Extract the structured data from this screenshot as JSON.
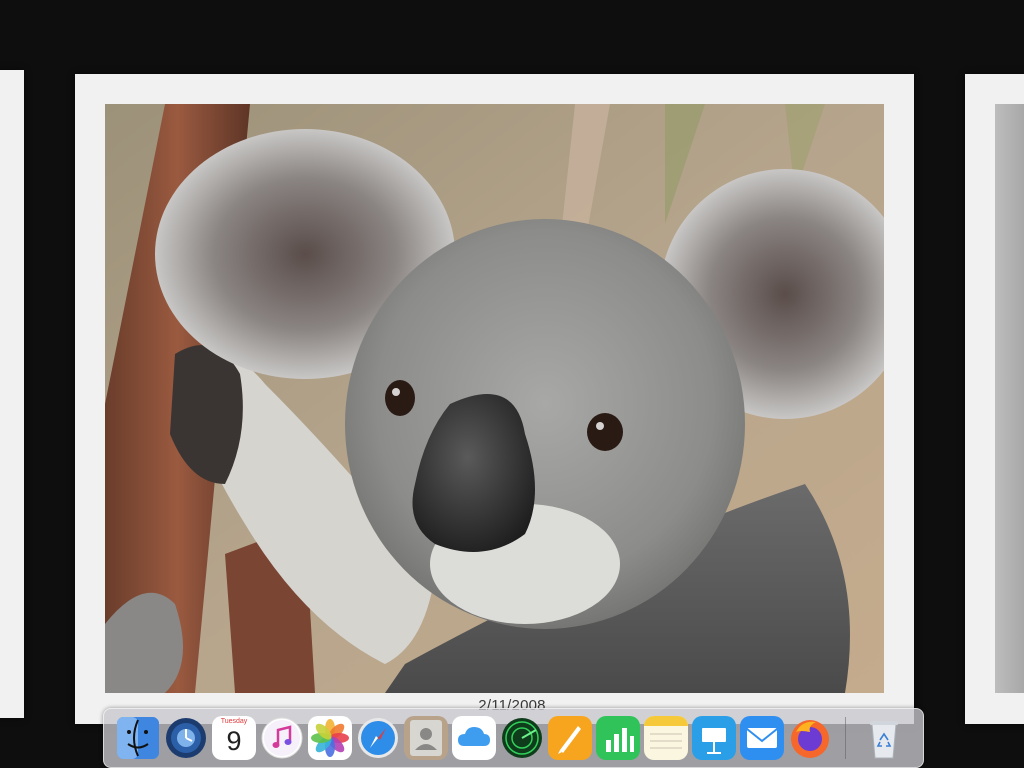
{
  "viewer": {
    "caption_date": "2/11/2008",
    "current_photo": "koala"
  },
  "dock": {
    "items": [
      {
        "name": "finder",
        "icon": "finder-icon"
      },
      {
        "name": "time-machine",
        "icon": "time-machine-icon"
      },
      {
        "name": "calendar",
        "icon": "calendar-icon",
        "month": "Tuesday",
        "day": "9"
      },
      {
        "name": "music",
        "icon": "music-icon"
      },
      {
        "name": "photos",
        "icon": "photos-icon"
      },
      {
        "name": "safari",
        "icon": "safari-icon"
      },
      {
        "name": "contacts",
        "icon": "contacts-icon"
      },
      {
        "name": "icloud",
        "icon": "icloud-icon"
      },
      {
        "name": "find-my",
        "icon": "radar-icon"
      },
      {
        "name": "pages",
        "icon": "pages-icon"
      },
      {
        "name": "numbers",
        "icon": "numbers-icon"
      },
      {
        "name": "notes",
        "icon": "notes-icon"
      },
      {
        "name": "keynote",
        "icon": "keynote-icon"
      },
      {
        "name": "mail",
        "icon": "mail-icon"
      },
      {
        "name": "firefox",
        "icon": "firefox-icon"
      },
      {
        "name": "recycle-bin",
        "icon": "recycle-bin-icon"
      }
    ]
  },
  "colors": {
    "background": "#0e0e0e",
    "frame": "#f1f1f1",
    "dock": "#c8c8cd"
  }
}
